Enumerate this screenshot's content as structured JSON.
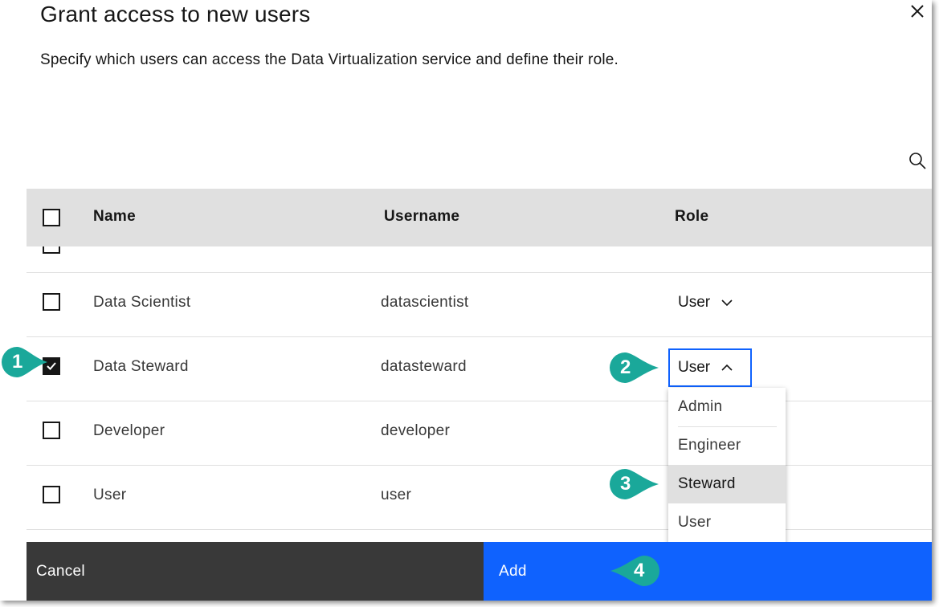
{
  "modal": {
    "title": "Grant access to new users",
    "subtitle": "Specify which users can access the Data Virtualization service and define their role."
  },
  "table": {
    "headers": {
      "name": "Name",
      "username": "Username",
      "role": "Role"
    },
    "rows": [
      {
        "name": "Data Scientist",
        "username": "datascientist",
        "role": "User",
        "checked": false
      },
      {
        "name": "Data Steward",
        "username": "datasteward",
        "role": "User",
        "checked": true
      },
      {
        "name": "Developer",
        "username": "developer",
        "role": "",
        "checked": false
      },
      {
        "name": "User",
        "username": "user",
        "role": "",
        "checked": false
      }
    ]
  },
  "role_menu": {
    "options": [
      "Admin",
      "Engineer",
      "Steward",
      "User"
    ],
    "highlighted": "Steward"
  },
  "footer": {
    "cancel_label": "Cancel",
    "add_label": "Add"
  },
  "callouts": {
    "c1": "1",
    "c2": "2",
    "c3": "3",
    "c4": "4"
  },
  "colors": {
    "accent": "#0f62fe",
    "callout": "#1aa89a",
    "header_bg": "#e0e0e0",
    "cancel_bg": "#393939"
  },
  "icons": {
    "close": "close-icon",
    "search": "search-icon",
    "chevron_down": "chevron-down-icon",
    "chevron_up": "chevron-up-icon",
    "checkmark": "checkmark-icon"
  }
}
